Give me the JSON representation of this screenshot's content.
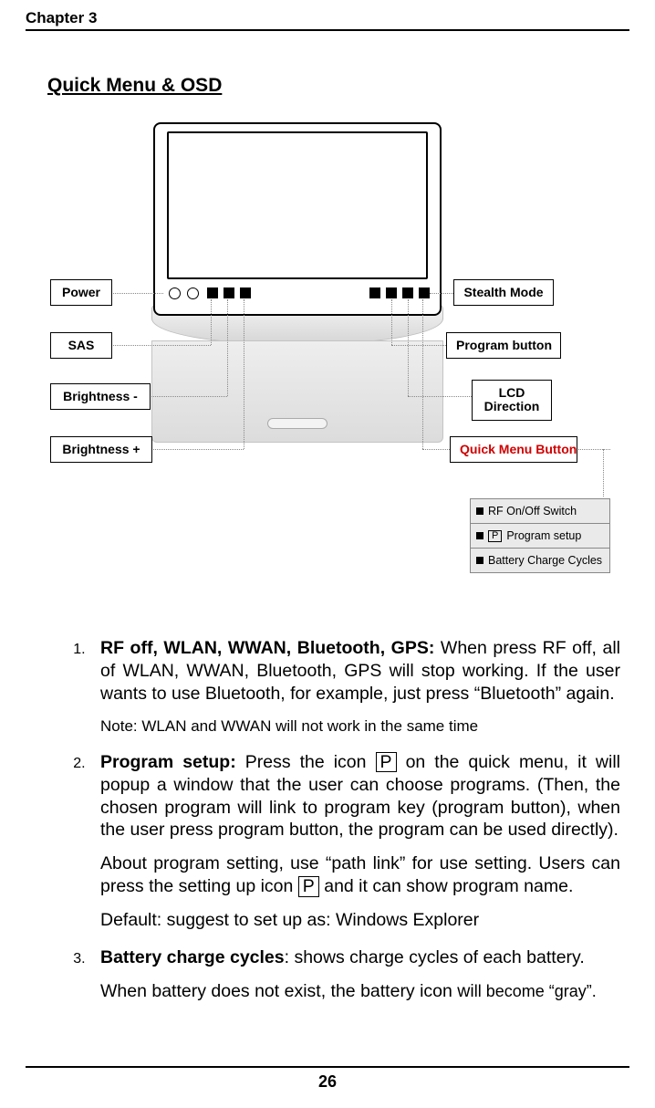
{
  "header": {
    "chapter": "Chapter 3"
  },
  "section_title": "Quick Menu & OSD",
  "diagram": {
    "labels": {
      "power": "Power",
      "sas": "SAS",
      "brightness_minus": "Brightness -",
      "brightness_plus": "Brightness +",
      "stealth_mode": "Stealth Mode",
      "program_button": "Program button",
      "lcd_direction": "LCD\nDirection",
      "quick_menu_button": "Quick Menu Button"
    },
    "menu": {
      "rf": "RF On/Off Switch",
      "program_setup_prefix": "P",
      "program_setup": "Program setup",
      "battery": "Battery Charge Cycles"
    }
  },
  "list": {
    "item1": {
      "bold_lead": "RF off, WLAN, WWAN, Bluetooth, GPS:",
      "text": " When press RF off, all of WLAN, WWAN, Bluetooth, GPS will stop working. If the user wants to use Bluetooth, for example, just press “Bluetooth” again.",
      "note": "Note: WLAN and WWAN will not work in the same time"
    },
    "item2": {
      "bold_lead": "Program setup:",
      "text_a": " Press the icon ",
      "icon_p": " P ",
      "text_b": " on the quick menu, it will popup a window that the user can choose programs. (Then, the chosen program will link to program key (program button), when the user press program button, the program can be used directly).",
      "para2_a": "  About program setting, use “path link” for use setting. Users can press the setting up icon ",
      "icon_p2": "P",
      "para2_b": " and it can show program name.",
      "default_line": "Default: suggest to set up as: Windows Explorer"
    },
    "item3": {
      "bold_lead": "Battery charge cycles",
      "text": ": shows charge cycles of each battery.",
      "para2_a": "When battery does not exist, the battery icon wi",
      "para2_b": "ll become “gray”."
    }
  },
  "page_number": "26"
}
